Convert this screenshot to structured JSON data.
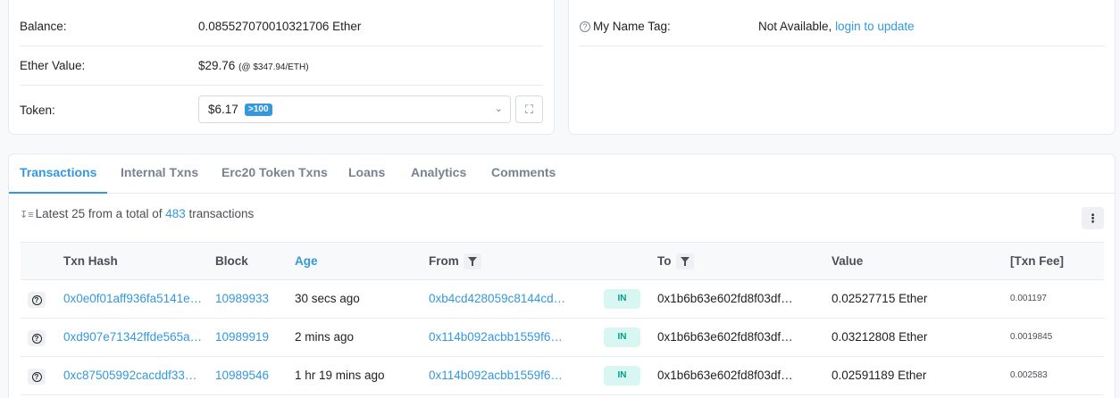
{
  "overview": {
    "balance": {
      "label": "Balance:",
      "value": "0.085527070010321706 Ether"
    },
    "ether_value": {
      "label": "Ether Value:",
      "value": "$29.76",
      "rate": "(@ $347.94/ETH)"
    },
    "token": {
      "label": "Token:",
      "amount": "$6.17",
      "count_badge": ">100",
      "chevron_icon": "chevron-down-icon",
      "expand_icon": "expand-icon"
    }
  },
  "more_info": {
    "name_tag": {
      "label": "My Name Tag:",
      "value": "Not Available, ",
      "link": "login to update"
    }
  },
  "tabs": [
    {
      "label": "Transactions",
      "active": true
    },
    {
      "label": "Internal Txns"
    },
    {
      "label": "Erc20 Token Txns"
    },
    {
      "label": "Loans"
    },
    {
      "label": "Analytics"
    },
    {
      "label": "Comments"
    }
  ],
  "summary": {
    "prefix": "Latest 25 from a total of ",
    "count": "483",
    "suffix": " transactions"
  },
  "table": {
    "headers": {
      "hash": "Txn Hash",
      "block": "Block",
      "age": "Age",
      "from": "From",
      "to": "To",
      "value": "Value",
      "fee": "[Txn Fee]"
    },
    "rows": [
      {
        "hash": "0x0e0f01aff936fa5141e…",
        "block": "10989933",
        "age": "30 secs ago",
        "from": "0xb4cd428059c8144cd…",
        "direction": "IN",
        "to": "0x1b6b63e602fd8f03df…",
        "value": "0.02527715 Ether",
        "fee": "0.001197"
      },
      {
        "hash": "0xd907e71342ffde565a…",
        "block": "10989919",
        "age": "2 mins ago",
        "from": "0x114b092acbb1559f6…",
        "direction": "IN",
        "to": "0x1b6b63e602fd8f03df…",
        "value": "0.03212808 Ether",
        "fee": "0.0019845"
      },
      {
        "hash": "0xc87505992cacddf33…",
        "block": "10989546",
        "age": "1 hr 19 mins ago",
        "from": "0x114b092acbb1559f6…",
        "direction": "IN",
        "to": "0x1b6b63e602fd8f03df…",
        "value": "0.02591189 Ether",
        "fee": "0.002583"
      }
    ]
  },
  "colors": {
    "link": "#3498db",
    "in_badge": "#00c9a7",
    "border": "#e7eaf3"
  }
}
